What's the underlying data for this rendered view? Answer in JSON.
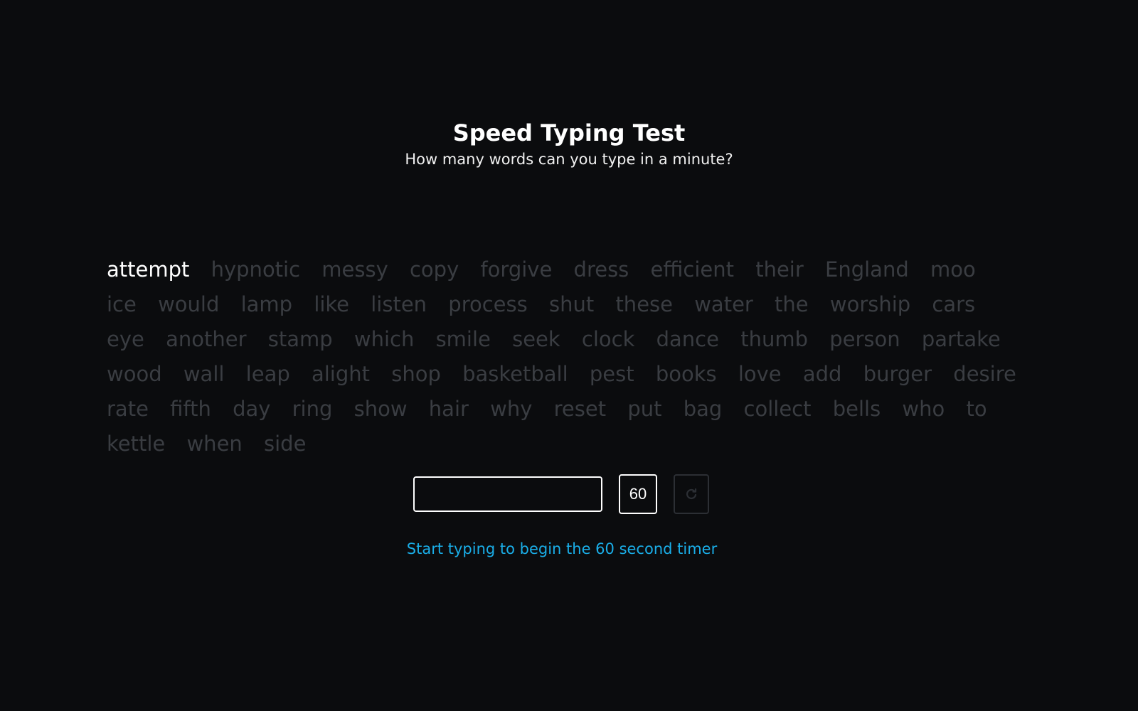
{
  "header": {
    "title": "Speed Typing Test",
    "subtitle": "How many words can you type in a minute?"
  },
  "words": {
    "current_index": 0,
    "list": [
      "attempt",
      "hypnotic",
      "messy",
      "copy",
      "forgive",
      "dress",
      "efficient",
      "their",
      "England",
      "moo",
      "ice",
      "would",
      "lamp",
      "like",
      "listen",
      "process",
      "shut",
      "these",
      "water",
      "the",
      "worship",
      "cars",
      "eye",
      "another",
      "stamp",
      "which",
      "smile",
      "seek",
      "clock",
      "dance",
      "thumb",
      "person",
      "partake",
      "wood",
      "wall",
      "leap",
      "alight",
      "shop",
      "basketball",
      "pest",
      "books",
      "love",
      "add",
      "burger",
      "desire",
      "rate",
      "fifth",
      "day",
      "ring",
      "show",
      "hair",
      "why",
      "reset",
      "put",
      "bag",
      "collect",
      "bells",
      "who",
      "to",
      "kettle",
      "when",
      "side"
    ]
  },
  "controls": {
    "input_value": "",
    "timer": "60",
    "reset_icon": "refresh-icon"
  },
  "instruction": "Start typing to begin the 60 second timer",
  "colors": {
    "background": "#0b0c0e",
    "current_word": "#ffffff",
    "upcoming_word": "#3a3d42",
    "instruction": "#1aaee8"
  }
}
